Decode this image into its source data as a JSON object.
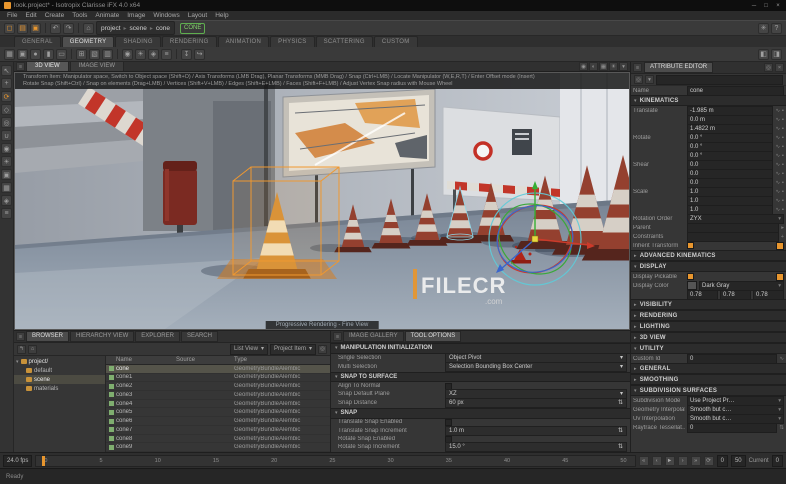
{
  "window": {
    "title": "look.project* - Isotropix Clarisse iFX 4.0 x64"
  },
  "menu": {
    "items": [
      "File",
      "Edit",
      "Create",
      "Tools",
      "Animate",
      "Image",
      "Windows",
      "Layout",
      "Help"
    ]
  },
  "breadcrumb": {
    "items": [
      "project",
      "scene",
      "cone"
    ],
    "badge": "CONE"
  },
  "shelf": {
    "tabs": [
      "GENERAL",
      "GEOMETRY",
      "SHADING",
      "RENDERING",
      "ANIMATION",
      "PHYSICS",
      "SCATTERING",
      "CUSTOM"
    ]
  },
  "viewport": {
    "tabs": [
      "3D VIEW",
      "IMAGE VIEW"
    ],
    "help1": "Transform Item: Manipulator space, Switch to Object space (Shift+O) / Axis Transforms (LMB Drag), Planar Transforms (MMB Drag) / Snap (Ctrl+LMB) / Locate Manipulator (W,E,R,T) / Enter Offset mode (Insert)",
    "help2": "Rotate Snap (Shift+Ctrl) / Snap on elements (Drag+LMB) / Vertices (Shift+V+LMB) / Edges (Shift+E+LMB) / Faces (Shift+F+LMB) / Adjust Vertex Snap radius with Mouse Wheel",
    "status": "Progressive Rendering - Fine View",
    "watermark": "FILECR",
    "watermark_sub": ".com"
  },
  "attr": {
    "tab": "ATTRIBUTE EDITOR",
    "name_label": "Name",
    "name_value": "cone",
    "sec_kinematics": "KINEMATICS",
    "translate_label": "Translate",
    "translate": [
      "-1.985 m",
      "0.0 m",
      "1.4822 m"
    ],
    "rotate_label": "Rotate",
    "rotate": [
      "0.0 °",
      "0.0 °",
      "0.0 °"
    ],
    "shear_label": "Shear",
    "shear": [
      "0.0",
      "0.0",
      "0.0"
    ],
    "scale_label": "Scale",
    "scale": [
      "1.0",
      "1.0",
      "1.0"
    ],
    "rotation_order_label": "Rotation Order",
    "rotation_order": "ZYX",
    "parent_label": "Parent",
    "parent": "",
    "constraints_label": "Constraints",
    "constraints_add": "+",
    "inherit_label": "Inherit Transform",
    "sec_advanced": "ADVANCED KINEMATICS",
    "sec_display": "DISPLAY",
    "pickable_label": "Display Pickable",
    "display_color_label": "Display Color",
    "display_color": "Dark Gray",
    "color_rgb": [
      "0.78",
      "0.78",
      "0.78"
    ],
    "sec_visibility": "VISIBILITY",
    "sec_rendering": "RENDERING",
    "sec_lighting": "LIGHTING",
    "sec_view3d": "3D VIEW",
    "sec_utility": "UTILITY",
    "custom_id_label": "Custom Id",
    "custom_id": "0",
    "sec_general": "GENERAL",
    "sec_smoothing": "SMOOTHING",
    "sec_subdiv": "SUBDIVISION SURFACES",
    "subdiv_mode_label": "Subdivision Mode",
    "subdiv_mode": "Use Project Pr…",
    "geo_interp_label": "Geometry Interpolation",
    "geo_interp": "Smooth but c…",
    "uv_interp_label": "Uv Interpolation",
    "uv_interp": "Smooth but c…",
    "raytrace_label": "Raytrace Tessellat…",
    "raytrace": "0"
  },
  "browser": {
    "tabs": [
      "BROWSER",
      "HIERARCHY VIEW",
      "EXPLORER",
      "SEARCH"
    ],
    "list_view": "List View",
    "filter": "Project Item",
    "tree_root": "project/",
    "tree_items": [
      "default",
      "scene",
      "materials"
    ],
    "columns": [
      "Name",
      "Source",
      "Type"
    ],
    "rows": [
      {
        "name": "cone",
        "source": "",
        "type": "GeometryBundleAlembic"
      },
      {
        "name": "cone1",
        "source": "",
        "type": "GeometryBundleAlembic"
      },
      {
        "name": "cone2",
        "source": "",
        "type": "GeometryBundleAlembic"
      },
      {
        "name": "cone3",
        "source": "",
        "type": "GeometryBundleAlembic"
      },
      {
        "name": "cone4",
        "source": "",
        "type": "GeometryBundleAlembic"
      },
      {
        "name": "cone5",
        "source": "",
        "type": "GeometryBundleAlembic"
      },
      {
        "name": "cone6",
        "source": "",
        "type": "GeometryBundleAlembic"
      },
      {
        "name": "cone7",
        "source": "",
        "type": "GeometryBundleAlembic"
      },
      {
        "name": "cone8",
        "source": "",
        "type": "GeometryBundleAlembic"
      },
      {
        "name": "cone9",
        "source": "",
        "type": "GeometryBundleAlembic"
      }
    ]
  },
  "tool": {
    "tabs": [
      "IMAGE GALLERY",
      "TOOL OPTIONS"
    ],
    "sec_manip": "MANIPULATION INITIALIZATION",
    "single_label": "Single Selection",
    "single": "Object Pivot",
    "multi_label": "Multi Selection",
    "multi": "Selection Bounding Box Center",
    "sec_snap_surface": "SNAP TO SURFACE",
    "align_label": "Align To Normal",
    "plane_label": "Snap Default Plane",
    "plane": "XZ",
    "dist_label": "Snap Distance",
    "dist": "60 px",
    "sec_snap": "SNAP",
    "tse_label": "Translate Snap Enabled",
    "tsi_label": "Translate Snap Increment",
    "tsi": "1.0 m",
    "rse_label": "Rotate Snap Enabled",
    "rsi_label": "Rotate Snap Increment",
    "rsi": "15.0 °"
  },
  "timeline": {
    "fps": "24.0 fps",
    "ticks": [
      "0",
      "5",
      "10",
      "15",
      "20",
      "25",
      "30",
      "35",
      "40",
      "45",
      "50"
    ],
    "start": "0",
    "end": "50",
    "current_label": "Current",
    "current": "0"
  },
  "status": {
    "left": "Ready"
  },
  "colors": {
    "accent": "#e8962e",
    "badge_green": "#5fae4f"
  }
}
